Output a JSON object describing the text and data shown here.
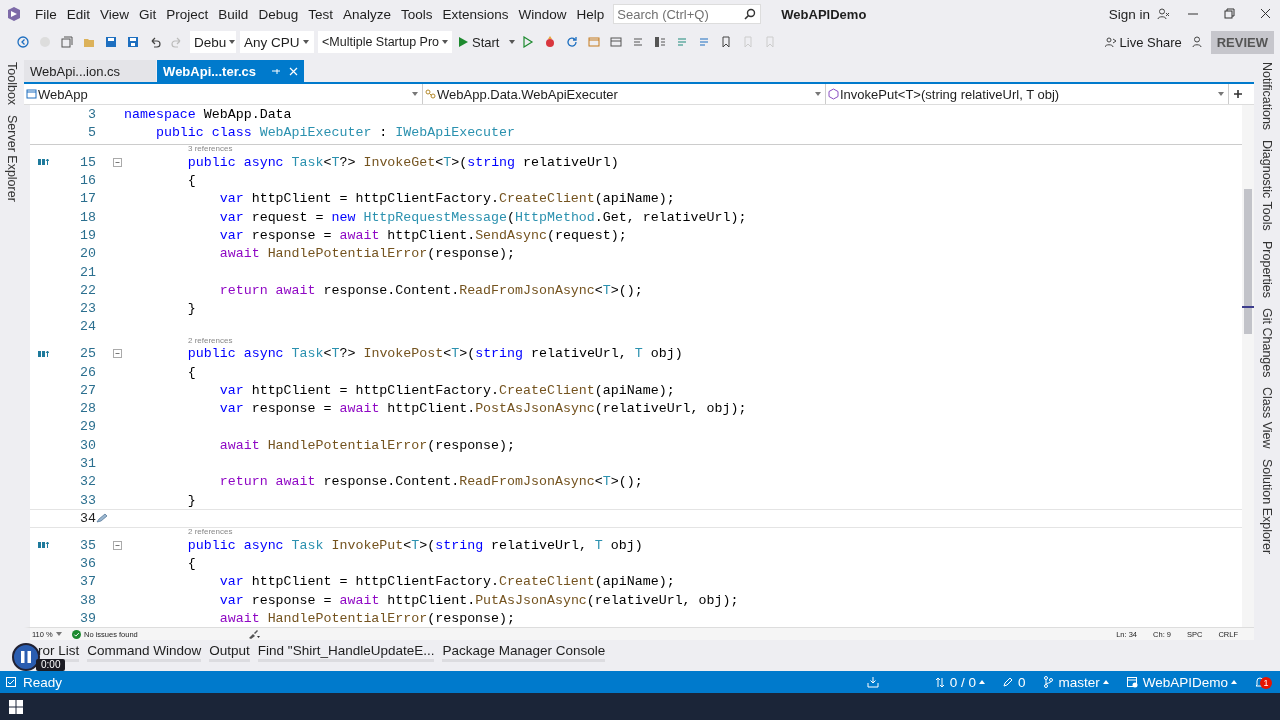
{
  "window": {
    "menu": [
      "File",
      "Edit",
      "View",
      "Git",
      "Project",
      "Build",
      "Debug",
      "Test",
      "Analyze",
      "Tools",
      "Extensions",
      "Window",
      "Help"
    ],
    "search": {
      "placeholder": "Search (Ctrl+Q)"
    },
    "title": "WebAPIDemo",
    "sign_in": "Sign in"
  },
  "toolbar": {
    "configuration": "Debu",
    "platform": "Any CPU",
    "startup": "<Multiple Startup Pro",
    "start": "Start",
    "live_share": "Live Share",
    "review": "REVIEW"
  },
  "tabs": [
    {
      "label": "WebApi...ion.cs",
      "selected": false
    },
    {
      "label": "WebApi...ter.cs",
      "selected": true
    }
  ],
  "nav_bar": [
    "WebApp",
    "WebApp.Data.WebApiExecuter",
    "InvokePut<T>(string relativeUrl, T obj)"
  ],
  "left_panels": [
    "Toolbox",
    "Server Explorer"
  ],
  "right_panels": [
    "Notifications",
    "Diagnostic Tools",
    "Properties",
    "Git Changes",
    "Class View",
    "Solution Explorer"
  ],
  "sticky_lines": [
    {
      "number": "3",
      "tokens": [
        {
          "kind": "kw",
          "text": "namespace"
        },
        {
          "kind": "text",
          "text": " WebApp.Data"
        }
      ]
    },
    {
      "number": "5",
      "tokens": [
        {
          "kind": "kw",
          "text": "    public class "
        },
        {
          "kind": "type",
          "text": "WebApiExecuter"
        },
        {
          "kind": "text",
          "text": " : "
        },
        {
          "kind": "type",
          "text": "IWebApiExecuter"
        }
      ]
    }
  ],
  "lines": [
    {
      "number": "15",
      "lens": "3 references",
      "marker": true,
      "fold": true,
      "current": false,
      "tokens": [
        {
          "kind": "kw",
          "text": "        public async "
        },
        {
          "kind": "type",
          "text": "Task"
        },
        {
          "kind": "text",
          "text": "<"
        },
        {
          "kind": "type",
          "text": "T"
        },
        {
          "kind": "text",
          "text": "?> "
        },
        {
          "kind": "method",
          "text": "InvokeGet"
        },
        {
          "kind": "text",
          "text": "<"
        },
        {
          "kind": "type",
          "text": "T"
        },
        {
          "kind": "text",
          "text": ">("
        },
        {
          "kind": "kw",
          "text": "string"
        },
        {
          "kind": "text",
          "text": " relativeUrl)"
        }
      ]
    },
    {
      "number": "16",
      "marker": false,
      "fold": false,
      "current": false,
      "tokens": [
        {
          "kind": "text",
          "text": "        {"
        }
      ]
    },
    {
      "number": "17",
      "marker": false,
      "fold": false,
      "current": false,
      "tokens": [
        {
          "kind": "kw",
          "text": "            var"
        },
        {
          "kind": "text",
          "text": " httpClient = httpClientFactory."
        },
        {
          "kind": "method",
          "text": "CreateClient"
        },
        {
          "kind": "text",
          "text": "(apiName);"
        }
      ]
    },
    {
      "number": "18",
      "marker": false,
      "fold": false,
      "current": false,
      "tokens": [
        {
          "kind": "kw",
          "text": "            var"
        },
        {
          "kind": "text",
          "text": " request = "
        },
        {
          "kind": "kw",
          "text": "new "
        },
        {
          "kind": "type",
          "text": "HttpRequestMessage"
        },
        {
          "kind": "text",
          "text": "("
        },
        {
          "kind": "type",
          "text": "HttpMethod"
        },
        {
          "kind": "text",
          "text": ".Get, relativeUrl);"
        }
      ]
    },
    {
      "number": "19",
      "marker": false,
      "fold": false,
      "current": false,
      "tokens": [
        {
          "kind": "kw",
          "text": "            var"
        },
        {
          "kind": "text",
          "text": " response = "
        },
        {
          "kind": "ctrl",
          "text": "await"
        },
        {
          "kind": "text",
          "text": " httpClient."
        },
        {
          "kind": "method",
          "text": "SendAsync"
        },
        {
          "kind": "text",
          "text": "(request);"
        }
      ]
    },
    {
      "number": "20",
      "marker": false,
      "fold": false,
      "current": false,
      "tokens": [
        {
          "kind": "ctrl",
          "text": "            await "
        },
        {
          "kind": "method",
          "text": "HandlePotentialError"
        },
        {
          "kind": "text",
          "text": "(response);"
        }
      ]
    },
    {
      "number": "21",
      "marker": false,
      "fold": false,
      "current": false
    },
    {
      "number": "22",
      "marker": false,
      "fold": false,
      "current": false,
      "tokens": [
        {
          "kind": "ctrl",
          "text": "            return await"
        },
        {
          "kind": "text",
          "text": " response.Content."
        },
        {
          "kind": "method",
          "text": "ReadFromJsonAsync"
        },
        {
          "kind": "text",
          "text": "<"
        },
        {
          "kind": "type",
          "text": "T"
        },
        {
          "kind": "text",
          "text": ">();"
        }
      ]
    },
    {
      "number": "23",
      "marker": false,
      "fold": false,
      "current": false,
      "tokens": [
        {
          "kind": "text",
          "text": "        }"
        }
      ]
    },
    {
      "number": "24",
      "marker": false,
      "fold": false,
      "current": false
    },
    {
      "number": "25",
      "lens": "2 references",
      "marker": true,
      "fold": true,
      "current": false,
      "tokens": [
        {
          "kind": "kw",
          "text": "        public async "
        },
        {
          "kind": "type",
          "text": "Task"
        },
        {
          "kind": "text",
          "text": "<"
        },
        {
          "kind": "type",
          "text": "T"
        },
        {
          "kind": "text",
          "text": "?> "
        },
        {
          "kind": "method",
          "text": "InvokePost"
        },
        {
          "kind": "text",
          "text": "<"
        },
        {
          "kind": "type",
          "text": "T"
        },
        {
          "kind": "text",
          "text": ">("
        },
        {
          "kind": "kw",
          "text": "string"
        },
        {
          "kind": "text",
          "text": " relativeUrl, "
        },
        {
          "kind": "type",
          "text": "T"
        },
        {
          "kind": "text",
          "text": " obj)"
        }
      ]
    },
    {
      "number": "26",
      "marker": false,
      "fold": false,
      "current": false,
      "tokens": [
        {
          "kind": "text",
          "text": "        {"
        }
      ]
    },
    {
      "number": "27",
      "marker": false,
      "fold": false,
      "current": false,
      "tokens": [
        {
          "kind": "kw",
          "text": "            var"
        },
        {
          "kind": "text",
          "text": " httpClient = httpClientFactory."
        },
        {
          "kind": "method",
          "text": "CreateClient"
        },
        {
          "kind": "text",
          "text": "(apiName);"
        }
      ]
    },
    {
      "number": "28",
      "marker": false,
      "fold": false,
      "current": false,
      "tokens": [
        {
          "kind": "kw",
          "text": "            var"
        },
        {
          "kind": "text",
          "text": " response = "
        },
        {
          "kind": "ctrl",
          "text": "await"
        },
        {
          "kind": "text",
          "text": " httpClient."
        },
        {
          "kind": "method",
          "text": "PostAsJsonAsync"
        },
        {
          "kind": "text",
          "text": "(relativeUrl, obj);"
        }
      ]
    },
    {
      "number": "29",
      "marker": false,
      "fold": false,
      "current": false
    },
    {
      "number": "30",
      "marker": false,
      "fold": false,
      "current": false,
      "tokens": [
        {
          "kind": "ctrl",
          "text": "            await "
        },
        {
          "kind": "method",
          "text": "HandlePotentialError"
        },
        {
          "kind": "text",
          "text": "(response);"
        }
      ]
    },
    {
      "number": "31",
      "marker": false,
      "fold": false,
      "current": false
    },
    {
      "number": "32",
      "marker": false,
      "fold": false,
      "current": false,
      "tokens": [
        {
          "kind": "ctrl",
          "text": "            return await"
        },
        {
          "kind": "text",
          "text": " response.Content."
        },
        {
          "kind": "method",
          "text": "ReadFromJsonAsync"
        },
        {
          "kind": "text",
          "text": "<"
        },
        {
          "kind": "type",
          "text": "T"
        },
        {
          "kind": "text",
          "text": ">();"
        }
      ]
    },
    {
      "number": "33",
      "marker": false,
      "fold": false,
      "current": false,
      "tokens": [
        {
          "kind": "text",
          "text": "        }"
        }
      ]
    },
    {
      "number": "34",
      "marker": false,
      "fold": false,
      "current": true
    },
    {
      "number": "35",
      "lens": "2 references",
      "marker": true,
      "fold": true,
      "current": false,
      "tokens": [
        {
          "kind": "kw",
          "text": "        public async "
        },
        {
          "kind": "type",
          "text": "Task "
        },
        {
          "kind": "method",
          "text": "InvokePut"
        },
        {
          "kind": "text",
          "text": "<"
        },
        {
          "kind": "type",
          "text": "T"
        },
        {
          "kind": "text",
          "text": ">("
        },
        {
          "kind": "kw",
          "text": "string"
        },
        {
          "kind": "text",
          "text": " relativeUrl, "
        },
        {
          "kind": "type",
          "text": "T"
        },
        {
          "kind": "text",
          "text": " obj)"
        }
      ]
    },
    {
      "number": "36",
      "marker": false,
      "fold": false,
      "current": false,
      "tokens": [
        {
          "kind": "text",
          "text": "        {"
        }
      ]
    },
    {
      "number": "37",
      "marker": false,
      "fold": false,
      "current": false,
      "tokens": [
        {
          "kind": "kw",
          "text": "            var"
        },
        {
          "kind": "text",
          "text": " httpClient = httpClientFactory."
        },
        {
          "kind": "method",
          "text": "CreateClient"
        },
        {
          "kind": "text",
          "text": "(apiName);"
        }
      ]
    },
    {
      "number": "38",
      "marker": false,
      "fold": false,
      "current": false,
      "tokens": [
        {
          "kind": "kw",
          "text": "            var"
        },
        {
          "kind": "text",
          "text": " response = "
        },
        {
          "kind": "ctrl",
          "text": "await"
        },
        {
          "kind": "text",
          "text": " httpClient."
        },
        {
          "kind": "method",
          "text": "PutAsJsonAsync"
        },
        {
          "kind": "text",
          "text": "(relativeUrl, obj);"
        }
      ]
    },
    {
      "number": "39",
      "marker": false,
      "fold": false,
      "current": false,
      "tokens": [
        {
          "kind": "ctrl",
          "text": "            await "
        },
        {
          "kind": "method",
          "text": "HandlePotentialError"
        },
        {
          "kind": "text",
          "text": "(response);"
        }
      ]
    }
  ],
  "editor_status": {
    "zoom": "110 %",
    "issues": "No issues found",
    "line": "Ln: 34",
    "column": "Ch: 9",
    "spacing": "SPC",
    "line_ending": "CRLF"
  },
  "tool_tabs": [
    "ror List",
    "Command Window",
    "Output",
    "Find \"Shirt_HandleUpdateE...",
    "Package Manager Console"
  ],
  "video_overlay": {
    "time": "0:00"
  },
  "status_bar": {
    "text": "Ready",
    "sync": "0 / 0",
    "changes": "0",
    "branch": "master",
    "repository": "WebAPIDemo",
    "notifications": "1"
  }
}
